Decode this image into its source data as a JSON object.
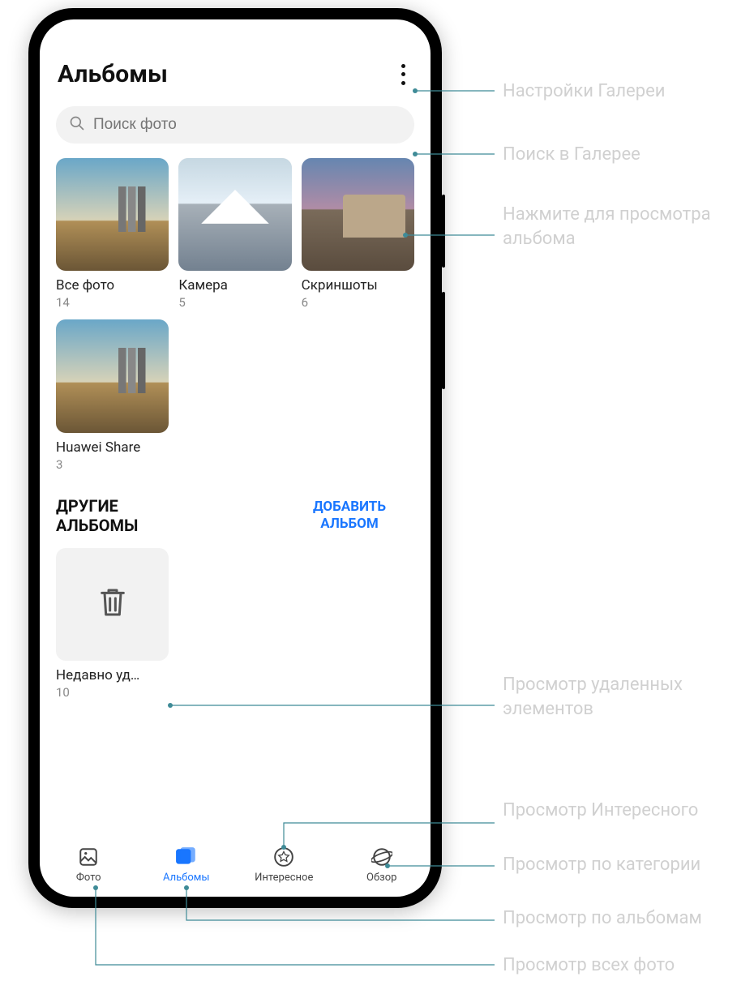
{
  "header": {
    "title": "Альбомы"
  },
  "search": {
    "placeholder": "Поиск фото"
  },
  "albums": [
    {
      "name": "Все фото",
      "count": "14"
    },
    {
      "name": "Камера",
      "count": "5"
    },
    {
      "name": "Скриншоты",
      "count": "6"
    },
    {
      "name": "Huawei Share",
      "count": "3"
    }
  ],
  "section": {
    "title": "ДРУГИЕ АЛЬБОМЫ",
    "add": "ДОБАВИТЬ АЛЬБОМ"
  },
  "other_albums": [
    {
      "name": "Недавно уд…",
      "count": "10"
    }
  ],
  "nav": [
    {
      "label": "Фото"
    },
    {
      "label": "Альбомы"
    },
    {
      "label": "Интересное"
    },
    {
      "label": "Обзор"
    }
  ],
  "callouts": {
    "settings": "Настройки Галереи",
    "search": "Поиск в Галерее",
    "album_tap": "Нажмите для просмотра альбома",
    "deleted": "Просмотр удаленных элементов",
    "interesting": "Просмотр Интересного",
    "category": "Просмотр по категории",
    "by_albums": "Просмотр по альбомам",
    "all_photos": "Просмотр всех фото"
  }
}
